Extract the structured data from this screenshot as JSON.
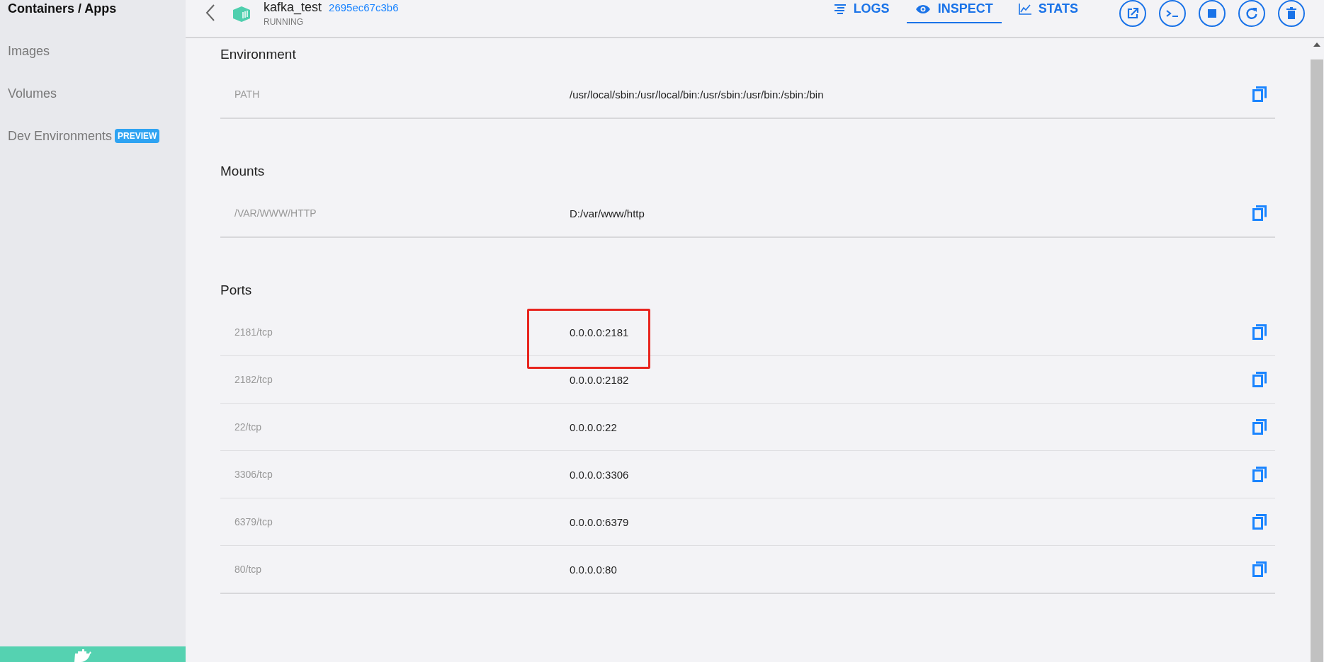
{
  "sidebar": {
    "items": [
      {
        "label": "Containers / Apps",
        "selected": true
      },
      {
        "label": "Images",
        "selected": false
      },
      {
        "label": "Volumes",
        "selected": false
      },
      {
        "label": "Dev Environments",
        "selected": false,
        "badge": "PREVIEW"
      }
    ]
  },
  "header": {
    "name": "kafka_test",
    "id": "2695ec67c3b6",
    "status": "RUNNING"
  },
  "tabs": [
    {
      "label": "LOGS",
      "kind": "logs",
      "selected": false
    },
    {
      "label": "INSPECT",
      "kind": "inspect",
      "selected": true
    },
    {
      "label": "STATS",
      "kind": "stats",
      "selected": false
    }
  ],
  "actions": [
    {
      "kind": "open"
    },
    {
      "kind": "cli"
    },
    {
      "kind": "stop"
    },
    {
      "kind": "restart"
    },
    {
      "kind": "delete"
    }
  ],
  "sections": [
    {
      "title": "Environment",
      "rows": [
        {
          "key": "PATH",
          "value": "/usr/local/sbin:/usr/local/bin:/usr/sbin:/usr/bin:/sbin:/bin",
          "highlighted": false
        }
      ]
    },
    {
      "title": "Mounts",
      "rows": [
        {
          "key": "/VAR/WWW/HTTP",
          "value": "D:/var/www/http",
          "highlighted": false
        }
      ]
    },
    {
      "title": "Ports",
      "rows": [
        {
          "key": "2181/tcp",
          "value": "0.0.0.0:2181",
          "highlighted": true
        },
        {
          "key": "2182/tcp",
          "value": "0.0.0.0:2182",
          "highlighted": false
        },
        {
          "key": "22/tcp",
          "value": "0.0.0.0:22",
          "highlighted": false
        },
        {
          "key": "3306/tcp",
          "value": "0.0.0.0:3306",
          "highlighted": false
        },
        {
          "key": "6379/tcp",
          "value": "0.0.0.0:6379",
          "highlighted": false
        },
        {
          "key": "80/tcp",
          "value": "0.0.0.0:80",
          "highlighted": false
        }
      ]
    }
  ]
}
